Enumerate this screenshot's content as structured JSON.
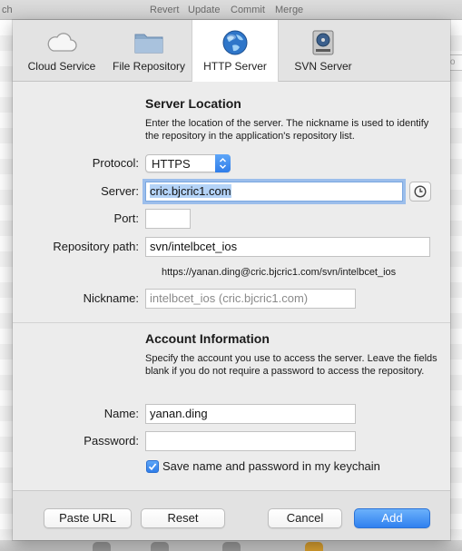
{
  "background": {
    "toolbar_items": [
      "ch",
      "Revert",
      "Update",
      "Commit",
      "Merge"
    ],
    "right_field_text": "utho"
  },
  "tabs": [
    {
      "label": "Cloud Service",
      "icon": "cloud-icon",
      "selected": false
    },
    {
      "label": "File Repository",
      "icon": "folder-icon",
      "selected": false
    },
    {
      "label": "HTTP Server",
      "icon": "globe-icon",
      "selected": true
    },
    {
      "label": "SVN Server",
      "icon": "server-drive-icon",
      "selected": false
    }
  ],
  "server_location": {
    "title": "Server Location",
    "description": "Enter the location of the server. The nickname is used to identify the repository in the application's repository list.",
    "protocol_label": "Protocol:",
    "protocol_value": "HTTPS",
    "server_label": "Server:",
    "server_value": "cric.bjcric1.com",
    "port_label": "Port:",
    "port_value": "",
    "repo_path_label": "Repository path:",
    "repo_path_value": "svn/intelbcet_ios",
    "url_preview": "https://yanan.ding@cric.bjcric1.com/svn/intelbcet_ios",
    "nickname_label": "Nickname:",
    "nickname_placeholder": "intelbcet_ios (cric.bjcric1.com)"
  },
  "account": {
    "title": "Account Information",
    "description": "Specify the account you use to access the server. Leave the fields blank if you do not require a password to access the repository.",
    "name_label": "Name:",
    "name_value": "yanan.ding",
    "password_label": "Password:",
    "password_value": "",
    "keychain_label": "Save name and password in my keychain",
    "keychain_checked": true
  },
  "footer": {
    "paste_url": "Paste URL",
    "reset": "Reset",
    "cancel": "Cancel",
    "add": "Add"
  },
  "colors": {
    "accent": "#2f80ef",
    "focus_ring": "#5b99eb",
    "sheet_bg": "#ececec"
  }
}
